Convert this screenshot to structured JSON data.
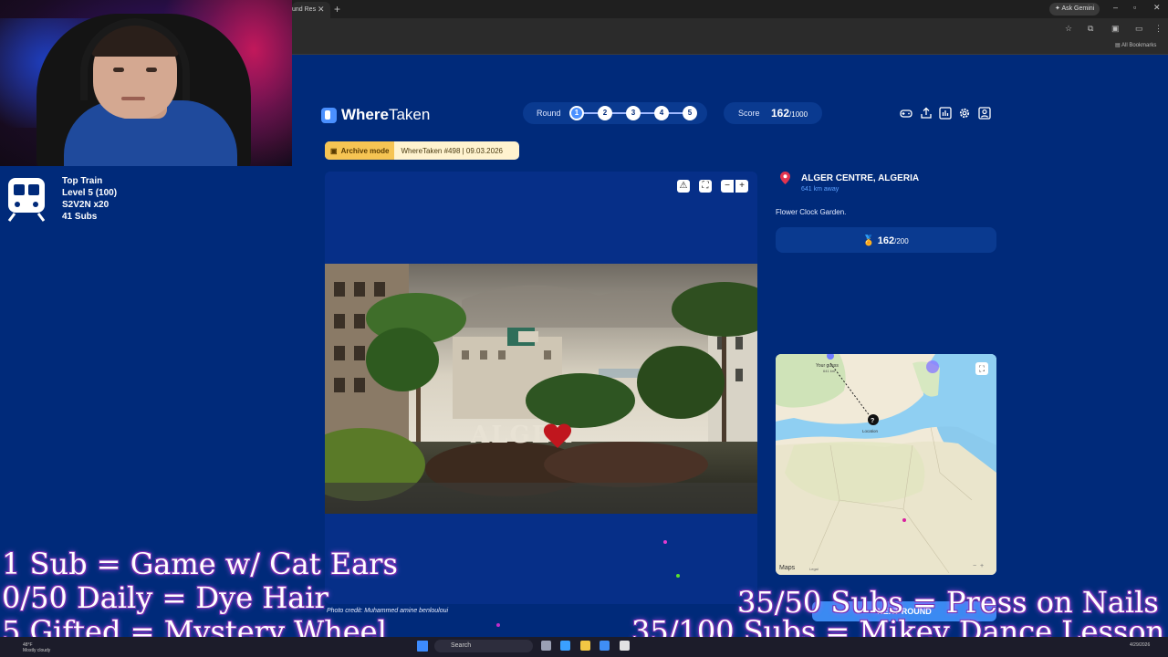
{
  "browser": {
    "tab_title": "und Res",
    "ask_gemini": "Ask Gemini",
    "all_bookmarks": "All Bookmarks"
  },
  "stream": {
    "train": {
      "title": "Top Train",
      "level": "Level 5 (100)",
      "user": "S2V2N x20",
      "subs": "41 Subs"
    },
    "goals": {
      "goal1": "1 Sub = Game w/ Cat Ears",
      "goal2": "0/50 Daily = Dye Hair",
      "goal3": "5 Gifted = Mystery Wheel",
      "goal4": "35/50 Subs = Press on Nails",
      "goal5": "35/100 Subs = Mikey Dance Lesson"
    }
  },
  "app": {
    "logo_where": "Where",
    "logo_taken": "Taken",
    "round_label": "Round",
    "rounds": [
      "1",
      "2",
      "3",
      "4",
      "5"
    ],
    "current_round": 1,
    "score_label": "Score",
    "score_value": "162",
    "score_max": "/1000",
    "header_icons": [
      "gamepad-icon",
      "share-icon",
      "stats-icon",
      "settings-icon",
      "profile-icon"
    ]
  },
  "archive": {
    "mode_label": "Archive mode",
    "puzzle_info": "WhereTaken #498 | 09.03.2026"
  },
  "photo": {
    "credit": "Photo credit: Muhammed amine benlouloui",
    "sign_text": "ALGER"
  },
  "result": {
    "location": "ALGER CENTRE, ALGERIA",
    "distance": "641 km away",
    "description": "Flower Clock Garden.",
    "points": "162",
    "points_max": "/200",
    "next_button": "NEXT ROUND"
  },
  "map": {
    "guess_label": "Your guess",
    "guess_distance": "641 km",
    "location_label": "Location",
    "maps_label": "Maps",
    "legal": "Legal"
  },
  "taskbar": {
    "weather_temp": "48°F",
    "weather_desc": "Mostly cloudy",
    "search_label": "Search",
    "date": "4/29/2026"
  },
  "colors": {
    "page_bg": "#002a7a",
    "accent": "#4a90ff",
    "archive_tag": "#f6c453",
    "distance_text": "#5ea2ff"
  }
}
